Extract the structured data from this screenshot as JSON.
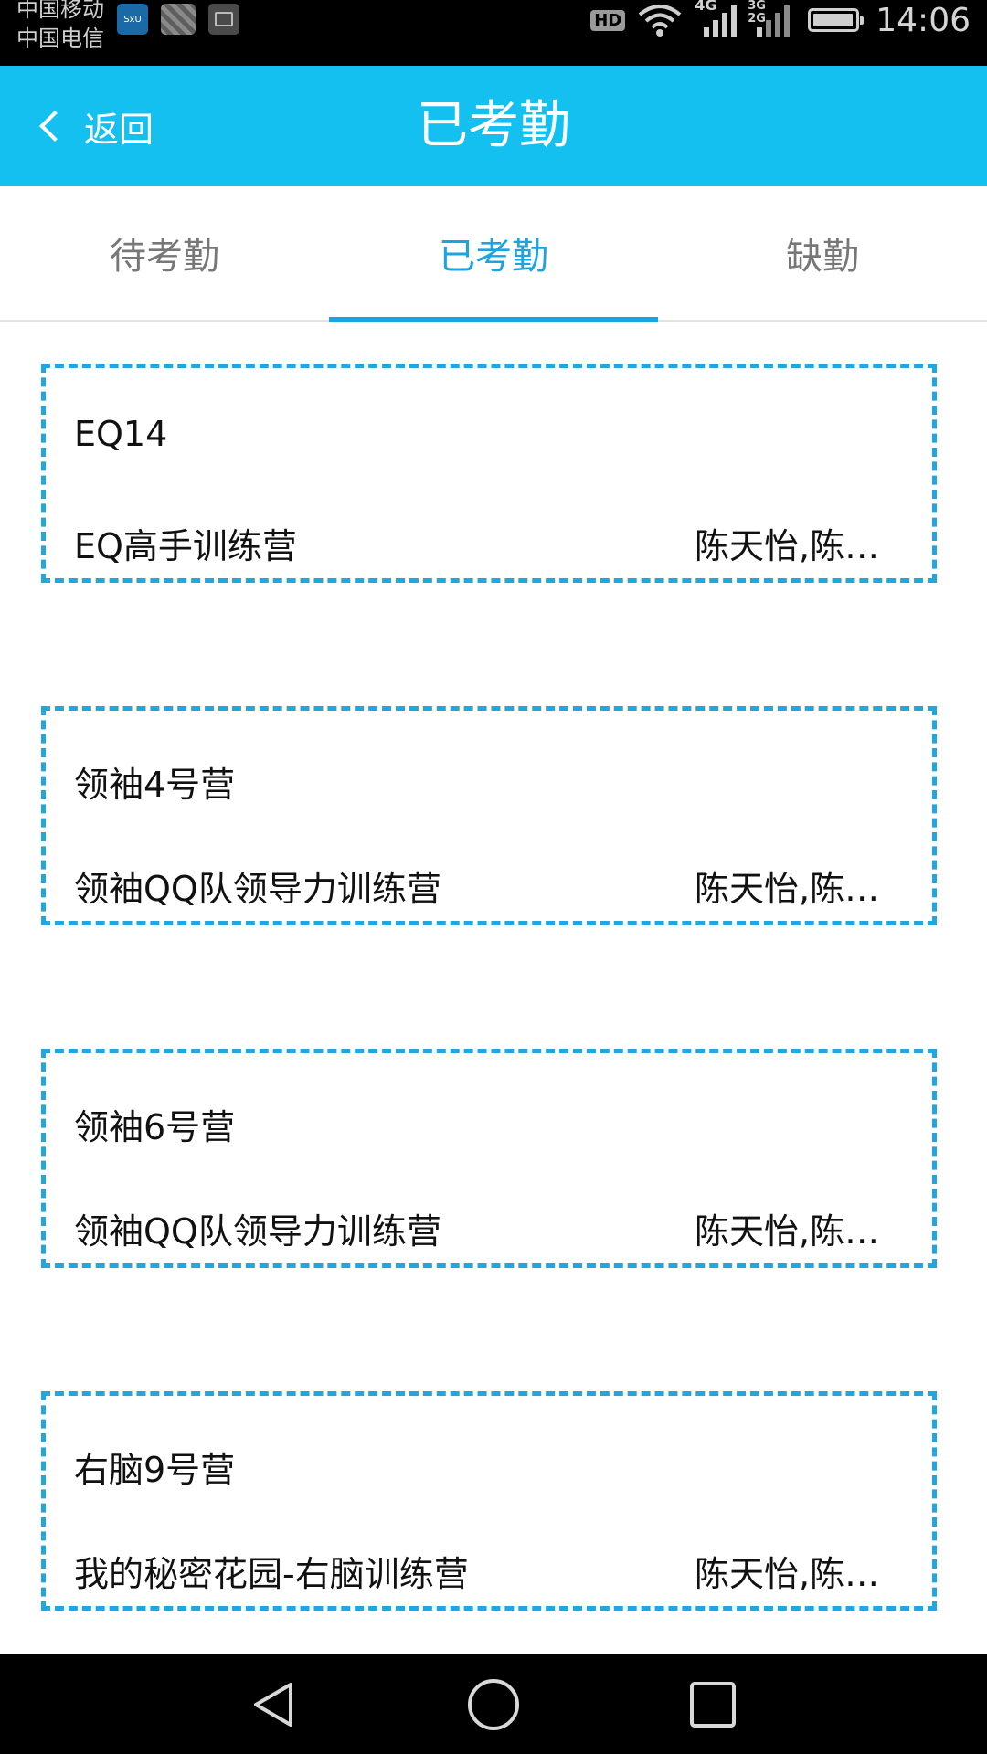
{
  "status_bar": {
    "carrier_1": "中国移动",
    "carrier_2": "中国电信",
    "app1_badge": "SxU",
    "hd": "HD",
    "net_1": "4G",
    "net_2": "3G 2G",
    "time": "14:06",
    "battery_level": 0.85,
    "icons": [
      "app-notification-icon",
      "photo-notification-icon",
      "gallery-notification-icon",
      "hd-icon",
      "wifi-icon",
      "signal-4g-icon",
      "signal-3g2g-icon",
      "battery-icon"
    ]
  },
  "header": {
    "back_label": "返回",
    "title": "已考勤",
    "background_color": "#13c0ef"
  },
  "tabs": [
    {
      "label": "待考勤",
      "active": false
    },
    {
      "label": "已考勤",
      "active": true
    },
    {
      "label": "缺勤",
      "active": false
    }
  ],
  "accent_color": "#1aa5e0",
  "records": [
    {
      "code": "EQ14",
      "course": "EQ高手训练营",
      "students": "陈天怡,陈天怡"
    },
    {
      "code": "领袖4号营",
      "course": "领袖QQ队领导力训练营",
      "students": "陈天怡,陈天怡"
    },
    {
      "code": "领袖6号营",
      "course": "领袖QQ队领导力训练营",
      "students": "陈天怡,陈天怡"
    },
    {
      "code": "右脑9号营",
      "course": "我的秘密花园-右脑训练营",
      "students": "陈天怡,陈天怡"
    }
  ],
  "nav_bar": {
    "icons": [
      "nav-back-icon",
      "nav-home-icon",
      "nav-recents-icon"
    ]
  }
}
